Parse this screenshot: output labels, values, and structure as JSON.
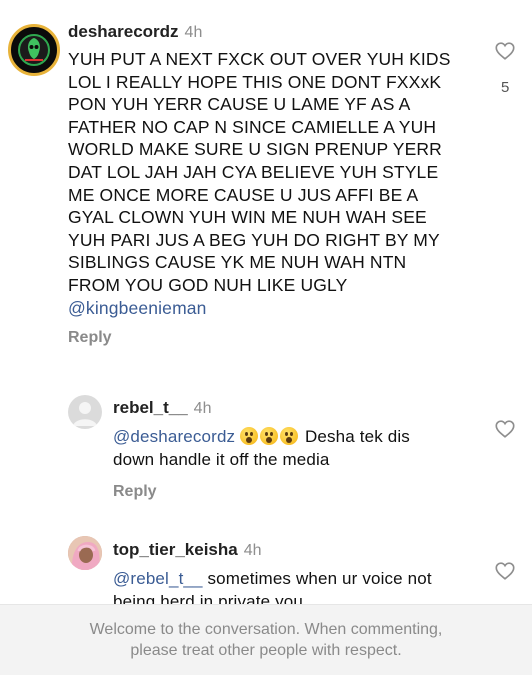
{
  "comments": [
    {
      "username": "desharecordz",
      "time": "4h",
      "text": "YUH PUT A NEXT FXCK OUT OVER YUH KIDS LOL I REALLY HOPE THIS ONE DONT FXXxK PON YUH YERR CAUSE U LAME YF AS A FATHER NO CAP N SINCE CAMIELLE A YUH WORLD MAKE SURE U SIGN PRENUP YERR DAT LOL JAH JAH CYA BELIEVE YUH STYLE ME ONCE MORE CAUSE U JUS AFFI BE A GYAL CLOWN YUH WIN ME NUH WAH SEE YUH PARI JUS A BEG YUH DO RIGHT BY MY SIBLINGS CAUSE YK ME NUH WAH NTN FROM YOU GOD NUH LIKE UGLY",
      "mention": "@kingbeenieman",
      "reply_label": "Reply",
      "likes": "5"
    },
    {
      "username": "rebel_t__",
      "time": "4h",
      "mention": "@desharecordz",
      "text": "Desha tek dis down handle it off the media",
      "reply_label": "Reply"
    },
    {
      "username": "top_tier_keisha",
      "time": "4h",
      "mention": "@rebel_t__",
      "text": "sometimes when ur voice not being herd in private you"
    }
  ],
  "footer": {
    "line1": "Welcome to the conversation. When commenting,",
    "line2": "please treat other people with respect."
  },
  "icons": {
    "like": "heart-outline-icon"
  },
  "colors": {
    "mention": "#3b5c94",
    "muted": "#8e8e8e"
  }
}
